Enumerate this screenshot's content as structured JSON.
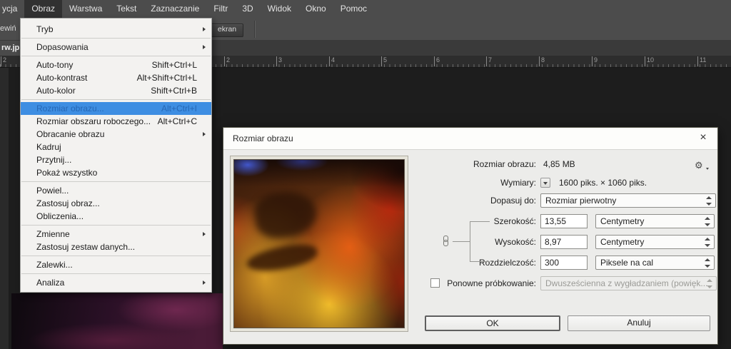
{
  "menubar": {
    "items": [
      {
        "label": "ycja"
      },
      {
        "label": "Obraz"
      },
      {
        "label": "Warstwa"
      },
      {
        "label": "Tekst"
      },
      {
        "label": "Zaznaczanie"
      },
      {
        "label": "Filtr"
      },
      {
        "label": "3D"
      },
      {
        "label": "Widok"
      },
      {
        "label": "Okno"
      },
      {
        "label": "Pomoc"
      }
    ]
  },
  "options_bar": {
    "left_partial": "ewiń",
    "screen_button_label": "ekran"
  },
  "document_tab": {
    "label": "rw.jp"
  },
  "ruler": {
    "left_partial": "2",
    "numbers": [
      "2",
      "3",
      "4",
      "5",
      "6",
      "7",
      "8",
      "9",
      "10",
      "11"
    ]
  },
  "menu": {
    "items": [
      {
        "label": "Tryb",
        "has_submenu": true
      },
      {
        "label": "Dopasowania",
        "has_submenu": true
      },
      {
        "label": "Auto-tony",
        "shortcut": "Shift+Ctrl+L"
      },
      {
        "label": "Auto-kontrast",
        "shortcut": "Alt+Shift+Ctrl+L"
      },
      {
        "label": "Auto-kolor",
        "shortcut": "Shift+Ctrl+B"
      },
      {
        "label": "Rozmiar obrazu...",
        "shortcut": "Alt+Ctrl+I",
        "highlighted": true
      },
      {
        "label": "Rozmiar obszaru roboczego...",
        "shortcut": "Alt+Ctrl+C"
      },
      {
        "label": "Obracanie obrazu",
        "has_submenu": true
      },
      {
        "label": "Kadruj"
      },
      {
        "label": "Przytnij..."
      },
      {
        "label": "Pokaż wszystko"
      },
      {
        "label": "Powiel..."
      },
      {
        "label": "Zastosuj obraz..."
      },
      {
        "label": "Obliczenia..."
      },
      {
        "label": "Zmienne",
        "has_submenu": true
      },
      {
        "label": "Zastosuj zestaw danych..."
      },
      {
        "label": "Zalewki..."
      },
      {
        "label": "Analiza",
        "has_submenu": true
      }
    ]
  },
  "dialog": {
    "title": "Rozmiar obrazu",
    "size_label": "Rozmiar obrazu:",
    "size_value": "4,85 MB",
    "dimensions_label": "Wymiary:",
    "dimensions_value": "1600 piks. × 1060 piks.",
    "fit_label": "Dopasuj do:",
    "fit_value": "Rozmiar pierwotny",
    "width_label": "Szerokość:",
    "width_value": "13,55",
    "width_unit": "Centymetry",
    "height_label": "Wysokość:",
    "height_value": "8,97",
    "height_unit": "Centymetry",
    "resolution_label": "Rozdzielczość:",
    "resolution_value": "300",
    "resolution_unit": "Piksele na cal",
    "resample_label": "Ponowne próbkowanie:",
    "resample_value": "Dwusześcienna z wygładzaniem (powięk...",
    "ok_label": "OK",
    "cancel_label": "Anuluj"
  },
  "colors": {
    "menu_highlight": "#3E8EE2",
    "menu_highlight_text": "#2667B5",
    "ui_dark": "#4C4C4C",
    "canvas_dark": "#1D1D1D",
    "dialog_bg": "#ECECEA"
  }
}
